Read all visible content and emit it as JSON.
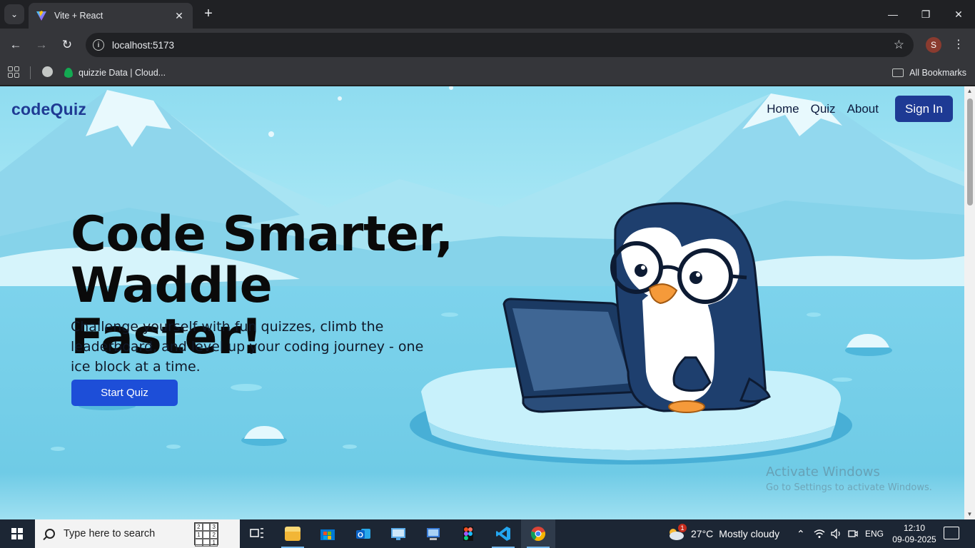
{
  "browser": {
    "tab_title": "Vite + React",
    "url": "localhost:5173",
    "bookmark_item": "quizzie Data | Cloud...",
    "all_bookmarks": "All Bookmarks",
    "profile_initial": "S"
  },
  "site": {
    "logo": "codeQuiz",
    "nav": [
      "Home",
      "Quiz",
      "About"
    ],
    "signin": "Sign In",
    "hero_line1": "Code Smarter,",
    "hero_line2": "Waddle Faster!",
    "hero_text": "Challenge yourself with fun quizzes, climb the leaderboard, and level up your coding journey - one ice block at a time.",
    "cta": "Start Quiz",
    "colors": {
      "logo": "#1f3a93",
      "signin": "#1e3a94",
      "cta": "#1d4ed8",
      "sky": "#7fd6ee"
    }
  },
  "watermark": {
    "line1": "Activate Windows",
    "line2": "Go to Settings to activate Windows."
  },
  "taskbar": {
    "search_placeholder": "Type here to search",
    "weather_temp": "27°C",
    "weather_desc": "Mostly cloudy",
    "weather_badge": "1",
    "language": "ENG",
    "time": "12:10",
    "date": "09-09-2025",
    "sudoku": [
      "2",
      "",
      "3",
      "1",
      "",
      "2",
      "",
      "",
      "1"
    ],
    "apps": [
      "task-view-icon",
      "file-explorer-icon",
      "microsoft-store-icon",
      "outlook-icon",
      "remote-desktop-icon",
      "control-panel-icon",
      "figma-icon",
      "vscode-icon",
      "chrome-icon"
    ]
  }
}
